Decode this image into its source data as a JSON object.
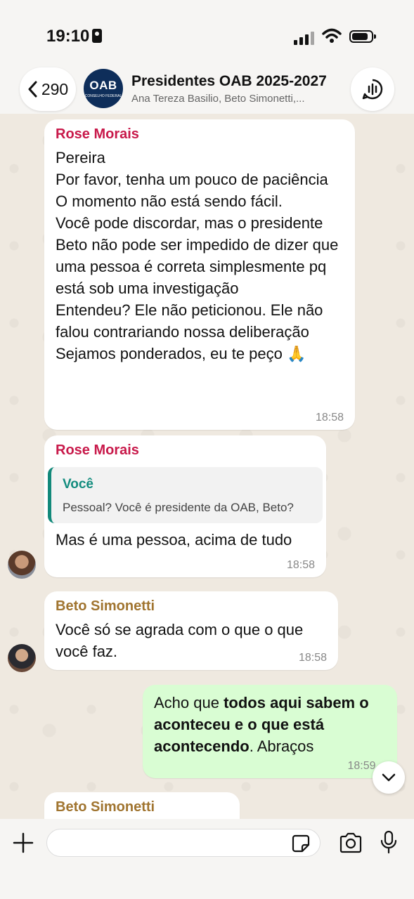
{
  "status": {
    "time": "19:10"
  },
  "header": {
    "back_count": "290",
    "avatar_text": "OAB",
    "avatar_sub": "CONSELHO FEDERAL",
    "title": "Presidentes OAB 2025-2027",
    "subtitle": "Ana Tereza Basilio, Beto Simonetti,..."
  },
  "messages": [
    {
      "sender": "Rose Morais",
      "lines": [
        "Pereira",
        "Por favor, tenha um pouco de paciência",
        "O momento não está sendo fácil.",
        "Você pode discordar, mas o presidente Beto não pode ser impedido de dizer que uma pessoa é correta simplesmente pq está sob uma investigação",
        "Entendeu? Ele não peticionou. Ele não falou contrariando nossa deliberação",
        "Sejamos ponderados, eu te peço 🙏"
      ],
      "time": "18:58"
    },
    {
      "sender": "Rose Morais",
      "quote_author": "Você",
      "quote_text": "Pessoal? Você é presidente da OAB, Beto?",
      "text": "Mas é uma pessoa, acima de tudo",
      "time": "18:58"
    },
    {
      "sender": "Beto Simonetti",
      "text": "Você só se agrada com o que o que você faz.",
      "time": "18:58"
    },
    {
      "outgoing": true,
      "pre": "Acho que ",
      "bold": "todos aqui sabem o aconteceu e o que está acontecendo",
      "post": ". Abraços",
      "time": "18:59"
    },
    {
      "sender": "Beto Simonetti"
    }
  ],
  "colors": {
    "rose": "#c8194a",
    "beto": "#a0742f",
    "quote_bar": "#12897a",
    "outgoing_bubble": "#d9fdd3"
  }
}
